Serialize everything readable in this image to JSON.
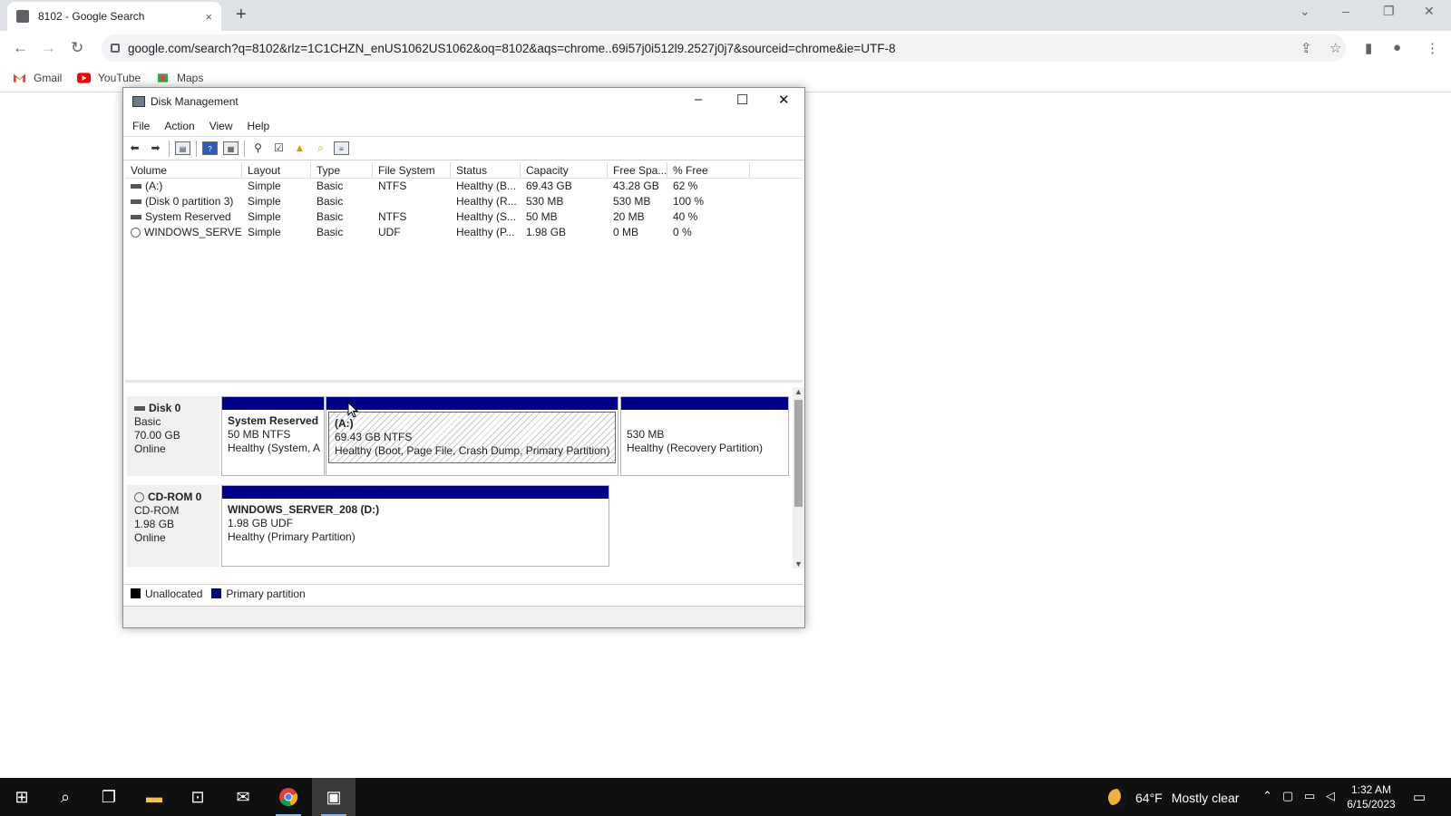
{
  "browser": {
    "tab_title": "8102 - Google Search",
    "tab_close": "×",
    "new_tab": "+",
    "window_controls": [
      "⌄",
      "–",
      "❐",
      "✕"
    ],
    "url": "google.com/search?q=8102&rlz=1C1CHZN_enUS1062US1062&oq=8102&aqs=chrome..69i57j0i512l9.2527j0j7&sourceid=chrome&ie=UTF-8",
    "bookmarks": [
      "Gmail",
      "YouTube",
      "Maps"
    ],
    "colors": {
      "tabstrip": "#dee1e6",
      "omnibox": "#f1f3f4"
    }
  },
  "disk_management": {
    "title": "Disk Management",
    "menu": [
      "File",
      "Action",
      "View",
      "Help"
    ],
    "columns": [
      "Volume",
      "Layout",
      "Type",
      "File System",
      "Status",
      "Capacity",
      "Free Spa...",
      "% Free"
    ],
    "volumes": [
      {
        "volume": "(A:)",
        "layout": "Simple",
        "type": "Basic",
        "fs": "NTFS",
        "status": "Healthy (B...",
        "capacity": "69.43 GB",
        "free": "43.28 GB",
        "pct": "62 %"
      },
      {
        "volume": "(Disk 0 partition 3)",
        "layout": "Simple",
        "type": "Basic",
        "fs": "",
        "status": "Healthy (R...",
        "capacity": "530 MB",
        "free": "530 MB",
        "pct": "100 %"
      },
      {
        "volume": "System Reserved",
        "layout": "Simple",
        "type": "Basic",
        "fs": "NTFS",
        "status": "Healthy (S...",
        "capacity": "50 MB",
        "free": "20 MB",
        "pct": "40 %"
      },
      {
        "volume": "WINDOWS_SERVE...",
        "layout": "Simple",
        "type": "Basic",
        "fs": "UDF",
        "status": "Healthy (P...",
        "capacity": "1.98 GB",
        "free": "0 MB",
        "pct": "0 %"
      }
    ],
    "disks": [
      {
        "name": "Disk 0",
        "type": "Basic",
        "size": "70.00 GB",
        "state": "Online",
        "partitions": [
          {
            "title": "System Reserved",
            "line2": "50 MB NTFS",
            "line3": "Healthy (System, A"
          },
          {
            "title": "(A:)",
            "line2": "69.43 GB NTFS",
            "line3": "Healthy (Boot, Page File, Crash Dump, Primary Partition)"
          },
          {
            "title": "",
            "line2": "530 MB",
            "line3": "Healthy (Recovery Partition)"
          }
        ]
      },
      {
        "name": "CD-ROM 0",
        "type": "CD-ROM",
        "size": "1.98 GB",
        "state": "Online",
        "partitions": [
          {
            "title": "WINDOWS_SERVER_208  (D:)",
            "line2": "1.98 GB UDF",
            "line3": "Healthy (Primary Partition)"
          }
        ]
      }
    ],
    "legend": [
      "Unallocated",
      "Primary partition"
    ],
    "colors": {
      "primary_partition": "#00008b",
      "unallocated": "#000000"
    }
  },
  "taskbar": {
    "weather_temp": "64°F",
    "weather_text": "Mostly clear",
    "time": "1:32 AM",
    "date": "6/15/2023"
  }
}
